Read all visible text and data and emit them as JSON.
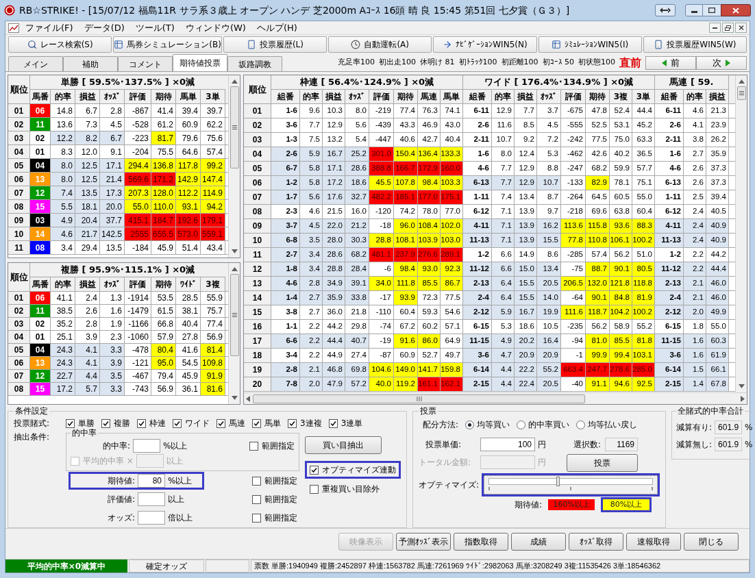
{
  "window": {
    "title": "RB☆STRIKE! - [15/07/12 福島11R サラ系３歳上 オープン ハンデ 芝2000m Aｺｰｽ  16頭 晴 良 15:45 第51回 七夕賞（Ｇ３）]"
  },
  "menu": [
    "ファイル(F)",
    "データ(D)",
    "ツール(T)",
    "ウィンドウ(W)",
    "ヘルプ(H)"
  ],
  "toolbar": [
    {
      "label": "レース検索(S)",
      "kind": "search"
    },
    {
      "label": "馬券シミュレーション(B)",
      "kind": "grid"
    },
    {
      "label": "投票履歴(L)",
      "kind": "doc"
    },
    {
      "label": "自動運転(A)",
      "kind": "clock"
    },
    {
      "label": "ﾅﾋﾞｹﾞｰｼｮﾝWIN5(N)",
      "kind": "arrow"
    },
    {
      "label": "ｼﾐｭﾚｰｼｮﾝWIN5(I)",
      "kind": "grid"
    },
    {
      "label": "投票履歴WIN5(W)",
      "kind": "doc"
    }
  ],
  "tabs": [
    {
      "label": "メイン",
      "selected": false
    },
    {
      "label": "補助",
      "selected": false
    },
    {
      "label": "コメント",
      "selected": false
    },
    {
      "label": "期待値投票",
      "selected": true
    },
    {
      "label": "坂路調教",
      "selected": false
    }
  ],
  "stats": [
    "充足率100",
    "初出走100",
    "休明け 81",
    "初ﾄﾗｯｸ100",
    "初距離100",
    "初ｺｰｽ 50",
    "初状態100"
  ],
  "timing": "直前",
  "nav": {
    "prev": "前",
    "next": "次"
  },
  "win_tables": [
    {
      "rank_header": "順位",
      "title": "単勝 [ 59.5%･137.5% ] ×0減",
      "headers": [
        "馬番",
        "的率",
        "損益",
        "ｵｯｽﾞ",
        "評価",
        "期待",
        "馬単",
        "3単"
      ],
      "rows": [
        {
          "rank": "01",
          "horse": "06",
          "color": "#ff0000",
          "selected": false,
          "cells": [
            "14.8",
            "6.7",
            "2.8",
            "-867",
            "41.4",
            "39.4",
            "39.7"
          ]
        },
        {
          "rank": "02",
          "horse": "11",
          "color": "#009900",
          "selected": false,
          "cells": [
            "13.6",
            "7.3",
            "4.5",
            "-528",
            "61.2",
            "60.9",
            "62.2"
          ]
        },
        {
          "rank": "03",
          "horse": "02",
          "color": "#ffffff",
          "selected": true,
          "cells": [
            "12.2",
            "8.2",
            "6.7",
            "-223",
            {
              "text": "81.7",
              "color": "#ffff00"
            },
            "79.6",
            "75.6"
          ]
        },
        {
          "rank": "04",
          "horse": "01",
          "color": "#ffffff",
          "selected": false,
          "cells": [
            "8.3",
            "12.0",
            "9.1",
            "-204",
            "75.5",
            "64.6",
            "57.4"
          ]
        },
        {
          "rank": "05",
          "horse": "04",
          "color": "#000000",
          "selected": true,
          "cells": [
            "8.0",
            "12.5",
            "17.1",
            {
              "text": "294.4",
              "color": "#ffff00"
            },
            {
              "text": "136.8",
              "color": "#ffff00"
            },
            {
              "text": "117.8",
              "color": "#ffff00"
            },
            {
              "text": "99.2",
              "color": "#ffff00"
            }
          ]
        },
        {
          "rank": "06",
          "horse": "13",
          "color": "#ff9900",
          "selected": true,
          "cells": [
            "8.0",
            "12.5",
            "21.4",
            {
              "text": "569.6",
              "color": "#ff0000"
            },
            {
              "text": "171.2",
              "color": "#ff0000"
            },
            {
              "text": "142.9",
              "color": "#ffff00"
            },
            {
              "text": "147.4",
              "color": "#ffff00"
            }
          ]
        },
        {
          "rank": "07",
          "horse": "12",
          "color": "#009900",
          "selected": true,
          "cells": [
            "7.4",
            "13.5",
            "17.3",
            {
              "text": "207.3",
              "color": "#ffff00"
            },
            {
              "text": "128.0",
              "color": "#ffff00"
            },
            {
              "text": "112.2",
              "color": "#ffff00"
            },
            {
              "text": "114.9",
              "color": "#ffff00"
            }
          ]
        },
        {
          "rank": "08",
          "horse": "15",
          "color": "#ff00ff",
          "selected": true,
          "cells": [
            "5.5",
            "18.1",
            "20.0",
            {
              "text": "55.0",
              "color": "#ffff00"
            },
            {
              "text": "110.0",
              "color": "#ffff00"
            },
            {
              "text": "93.1",
              "color": "#ffff00"
            },
            {
              "text": "94.2",
              "color": "#ffff00"
            }
          ]
        },
        {
          "rank": "09",
          "horse": "03",
          "color": "#000000",
          "selected": true,
          "cells": [
            "4.9",
            "20.4",
            "37.7",
            {
              "text": "415.1",
              "color": "#ff0000"
            },
            {
              "text": "184.7",
              "color": "#ff0000"
            },
            {
              "text": "192.6",
              "color": "#ff0000"
            },
            {
              "text": "179.1",
              "color": "#ff0000"
            }
          ]
        },
        {
          "rank": "10",
          "horse": "14",
          "color": "#ff9900",
          "selected": true,
          "cells": [
            "4.6",
            "21.7",
            "142.5",
            {
              "text": "2555",
              "color": "#ff0000"
            },
            {
              "text": "655.5",
              "color": "#ff0000"
            },
            {
              "text": "573.0",
              "color": "#ff0000"
            },
            {
              "text": "559.1",
              "color": "#ff0000"
            }
          ]
        },
        {
          "rank": "11",
          "horse": "08",
          "color": "#0000ff",
          "selected": false,
          "cells": [
            "3.4",
            "29.4",
            "13.5",
            "-184",
            "45.9",
            "51.4",
            "43.4"
          ]
        }
      ]
    },
    {
      "rank_header": "順位",
      "title": "複勝 [ 95.9%･115.1% ] ×0減",
      "headers": [
        "馬番",
        "的率",
        "損益",
        "ｵｯｽﾞ",
        "評価",
        "期待",
        "ﾜｲﾄﾞ",
        "3複"
      ],
      "rows": [
        {
          "rank": "01",
          "horse": "06",
          "color": "#ff0000",
          "selected": false,
          "cells": [
            "41.1",
            "2.4",
            "1.3",
            "-1914",
            "53.5",
            "28.5",
            "55.9"
          ]
        },
        {
          "rank": "02",
          "horse": "11",
          "color": "#009900",
          "selected": false,
          "cells": [
            "38.5",
            "2.6",
            "1.6",
            "-1479",
            "61.5",
            "38.1",
            "75.7"
          ]
        },
        {
          "rank": "03",
          "horse": "02",
          "color": "#ffffff",
          "selected": false,
          "cells": [
            "35.2",
            "2.8",
            "1.9",
            "-1166",
            "66.8",
            "40.4",
            "77.4"
          ]
        },
        {
          "rank": "04",
          "horse": "01",
          "color": "#ffffff",
          "selected": false,
          "cells": [
            "25.1",
            "3.9",
            "2.3",
            "-1060",
            "57.9",
            "27.8",
            "56.9"
          ]
        },
        {
          "rank": "05",
          "horse": "04",
          "color": "#000000",
          "selected": true,
          "cells": [
            "24.3",
            "4.1",
            "3.3",
            "-478",
            {
              "text": "80.4",
              "color": "#ffff00"
            },
            "41.6",
            {
              "text": "81.4",
              "color": "#ffff00"
            }
          ]
        },
        {
          "rank": "06",
          "horse": "13",
          "color": "#ff9900",
          "selected": true,
          "cells": [
            "24.3",
            "4.1",
            "3.9",
            "-121",
            {
              "text": "95.0",
              "color": "#ffff00"
            },
            "54.5",
            {
              "text": "109.8",
              "color": "#ffff00"
            }
          ]
        },
        {
          "rank": "07",
          "horse": "12",
          "color": "#009900",
          "selected": true,
          "cells": [
            "22.7",
            "4.4",
            "3.5",
            "-467",
            "79.4",
            "45.9",
            {
              "text": "91.9",
              "color": "#ffff00"
            }
          ]
        },
        {
          "rank": "08",
          "horse": "15",
          "color": "#ff00ff",
          "selected": true,
          "cells": [
            "17.2",
            "5.7",
            "3.3",
            "-743",
            "56.9",
            "36.1",
            {
              "text": "81.6",
              "color": "#ffff00"
            }
          ]
        }
      ]
    }
  ],
  "grid": {
    "rank_header": "順位",
    "sections": [
      {
        "title": "枠連 [ 56.4%･124.9% ] ×0減",
        "headers": [
          "組番",
          "的率",
          "損益",
          "ｵｯｽﾞ",
          "評価",
          "期待",
          "馬連",
          "馬単"
        ]
      },
      {
        "title": "ワイド [ 176.4%･134.9% ] ×0減",
        "headers": [
          "組番",
          "的率",
          "損益",
          "ｵｯｽﾞ",
          "評価",
          "期待",
          "3複",
          "3単"
        ]
      },
      {
        "title": "馬連 [ 59.",
        "headers": [
          "組番",
          "的率",
          "損益"
        ]
      }
    ],
    "rows": [
      {
        "rank": "01",
        "groups": [
          {
            "combo": "1-6",
            "selected": false,
            "cells": [
              "9.6",
              "10.3",
              "8.0",
              "-219",
              "77.4",
              "76.3",
              "74.1"
            ]
          },
          {
            "combo": "6-11",
            "selected": false,
            "cells": [
              "12.9",
              "7.7",
              "3.7",
              "-675",
              "47.8",
              "52.4",
              "44.4"
            ]
          },
          {
            "combo": "6-11",
            "selected": false,
            "cells": [
              "4.6",
              "21.3"
            ]
          }
        ]
      },
      {
        "rank": "02",
        "groups": [
          {
            "combo": "3-6",
            "selected": false,
            "cells": [
              "7.7",
              "12.9",
              "5.6",
              "-439",
              "43.3",
              "46.9",
              "43.0"
            ]
          },
          {
            "combo": "2-6",
            "selected": false,
            "cells": [
              "11.6",
              "8.5",
              "4.5",
              "-555",
              "52.5",
              "53.1",
              "45.2"
            ]
          },
          {
            "combo": "2-6",
            "selected": false,
            "cells": [
              "4.1",
              "23.9"
            ]
          }
        ]
      },
      {
        "rank": "03",
        "groups": [
          {
            "combo": "1-3",
            "selected": false,
            "cells": [
              "7.5",
              "13.2",
              "5.4",
              "-447",
              "40.6",
              "42.7",
              "40.4"
            ]
          },
          {
            "combo": "2-11",
            "selected": false,
            "cells": [
              "10.7",
              "9.2",
              "7.2",
              "-242",
              "77.5",
              "75.0",
              "63.3"
            ]
          },
          {
            "combo": "2-11",
            "selected": false,
            "cells": [
              "3.8",
              "26.2"
            ]
          }
        ]
      },
      {
        "rank": "04",
        "groups": [
          {
            "combo": "2-6",
            "selected": true,
            "cells": [
              "5.9",
              "16.7",
              "25.2",
              {
                "text": "301.0",
                "color": "#ff0000"
              },
              {
                "text": "150.4",
                "color": "#ffff00"
              },
              {
                "text": "136.4",
                "color": "#ffff00"
              },
              {
                "text": "133.3",
                "color": "#ffff00"
              }
            ]
          },
          {
            "combo": "1-6",
            "selected": false,
            "cells": [
              "8.0",
              "12.4",
              "5.3",
              "-462",
              "42.6",
              "40.2",
              "36.5"
            ]
          },
          {
            "combo": "1-6",
            "selected": false,
            "cells": [
              "2.7",
              "35.9"
            ]
          }
        ]
      },
      {
        "rank": "05",
        "groups": [
          {
            "combo": "6-7",
            "selected": true,
            "cells": [
              "5.8",
              "17.1",
              "28.6",
              {
                "text": "388.8",
                "color": "#ff0000"
              },
              {
                "text": "166.7",
                "color": "#ff0000"
              },
              {
                "text": "172.9",
                "color": "#ff0000"
              },
              {
                "text": "160.0",
                "color": "#ff0000"
              }
            ]
          },
          {
            "combo": "4-6",
            "selected": false,
            "cells": [
              "7.7",
              "12.9",
              "8.8",
              "-247",
              "68.2",
              "59.9",
              "57.7"
            ]
          },
          {
            "combo": "4-6",
            "selected": false,
            "cells": [
              "2.6",
              "37.3"
            ]
          }
        ]
      },
      {
        "rank": "06",
        "groups": [
          {
            "combo": "1-2",
            "selected": true,
            "cells": [
              "5.8",
              "17.2",
              "18.6",
              {
                "text": "45.5",
                "color": "#ffff00"
              },
              {
                "text": "107.8",
                "color": "#ffff00"
              },
              {
                "text": "98.4",
                "color": "#ffff00"
              },
              {
                "text": "103.3",
                "color": "#ffff00"
              }
            ]
          },
          {
            "combo": "6-13",
            "selected": true,
            "cells": [
              "7.7",
              "12.9",
              "10.7",
              "-133",
              {
                "text": "82.9",
                "color": "#ffff00"
              },
              "78.1",
              "75.1"
            ]
          },
          {
            "combo": "6-13",
            "selected": false,
            "cells": [
              "2.6",
              "37.3"
            ]
          }
        ]
      },
      {
        "rank": "07",
        "groups": [
          {
            "combo": "1-7",
            "selected": true,
            "cells": [
              "5.6",
              "17.6",
              "32.7",
              {
                "text": "482.2",
                "color": "#ff0000"
              },
              {
                "text": "185.1",
                "color": "#ff0000"
              },
              {
                "text": "177.0",
                "color": "#ff0000"
              },
              {
                "text": "175.1",
                "color": "#ff0000"
              }
            ]
          },
          {
            "combo": "1-11",
            "selected": false,
            "cells": [
              "7.4",
              "13.4",
              "8.7",
              "-264",
              "64.5",
              "60.5",
              "55.0"
            ]
          },
          {
            "combo": "1-11",
            "selected": false,
            "cells": [
              "2.5",
              "39.4"
            ]
          }
        ]
      },
      {
        "rank": "08",
        "groups": [
          {
            "combo": "2-3",
            "selected": false,
            "cells": [
              "4.6",
              "21.5",
              "16.0",
              "-120",
              "74.2",
              "78.0",
              "77.0"
            ]
          },
          {
            "combo": "6-12",
            "selected": false,
            "cells": [
              "7.1",
              "13.9",
              "9.7",
              "-218",
              "69.6",
              "63.8",
              "60.4"
            ]
          },
          {
            "combo": "6-12",
            "selected": false,
            "cells": [
              "2.4",
              "40.5"
            ]
          }
        ]
      },
      {
        "rank": "09",
        "groups": [
          {
            "combo": "3-7",
            "selected": true,
            "cells": [
              "4.5",
              "22.0",
              "21.2",
              "-18",
              {
                "text": "96.0",
                "color": "#ffff00"
              },
              {
                "text": "108.4",
                "color": "#ffff00"
              },
              {
                "text": "102.0",
                "color": "#ffff00"
              }
            ]
          },
          {
            "combo": "4-11",
            "selected": true,
            "cells": [
              "7.1",
              "13.9",
              "16.2",
              {
                "text": "113.6",
                "color": "#ffff00"
              },
              {
                "text": "115.8",
                "color": "#ffff00"
              },
              {
                "text": "93.6",
                "color": "#ffff00"
              },
              {
                "text": "88.3",
                "color": "#ffff00"
              }
            ]
          },
          {
            "combo": "4-11",
            "selected": true,
            "cells": [
              "2.4",
              "40.9"
            ]
          }
        ]
      },
      {
        "rank": "10",
        "groups": [
          {
            "combo": "6-8",
            "selected": true,
            "cells": [
              "3.5",
              "28.0",
              "30.3",
              {
                "text": "28.8",
                "color": "#ffff00"
              },
              {
                "text": "108.1",
                "color": "#ffff00"
              },
              {
                "text": "103.9",
                "color": "#ffff00"
              },
              {
                "text": "103.0",
                "color": "#ffff00"
              }
            ]
          },
          {
            "combo": "11-13",
            "selected": true,
            "cells": [
              "7.1",
              "13.9",
              "15.5",
              {
                "text": "77.8",
                "color": "#ffff00"
              },
              {
                "text": "110.8",
                "color": "#ffff00"
              },
              {
                "text": "106.1",
                "color": "#ffff00"
              },
              {
                "text": "100.2",
                "color": "#ffff00"
              }
            ]
          },
          {
            "combo": "11-13",
            "selected": true,
            "cells": [
              "2.4",
              "40.9"
            ]
          }
        ]
      },
      {
        "rank": "11",
        "groups": [
          {
            "combo": "2-7",
            "selected": true,
            "cells": [
              "3.4",
              "28.6",
              "68.2",
              {
                "text": "481.1",
                "color": "#ff0000"
              },
              {
                "text": "237.9",
                "color": "#ff0000"
              },
              {
                "text": "276.6",
                "color": "#ff0000"
              },
              {
                "text": "289.1",
                "color": "#ff0000"
              }
            ]
          },
          {
            "combo": "1-2",
            "selected": false,
            "cells": [
              "6.6",
              "14.9",
              "8.6",
              "-285",
              "57.4",
              "56.2",
              "51.0"
            ]
          },
          {
            "combo": "1-2",
            "selected": false,
            "cells": [
              "2.2",
              "44.2"
            ]
          }
        ]
      },
      {
        "rank": "12",
        "groups": [
          {
            "combo": "1-8",
            "selected": true,
            "cells": [
              "3.4",
              "28.8",
              "28.4",
              "-6",
              {
                "text": "98.4",
                "color": "#ffff00"
              },
              {
                "text": "93.0",
                "color": "#ffff00"
              },
              {
                "text": "92.3",
                "color": "#ffff00"
              }
            ]
          },
          {
            "combo": "11-12",
            "selected": true,
            "cells": [
              "6.6",
              "15.0",
              "13.4",
              "-75",
              {
                "text": "88.7",
                "color": "#ffff00"
              },
              {
                "text": "90.1",
                "color": "#ffff00"
              },
              {
                "text": "80.5",
                "color": "#ffff00"
              }
            ]
          },
          {
            "combo": "11-12",
            "selected": true,
            "cells": [
              "2.2",
              "44.4"
            ]
          }
        ]
      },
      {
        "rank": "13",
        "groups": [
          {
            "combo": "4-6",
            "selected": true,
            "cells": [
              "2.8",
              "34.9",
              "39.1",
              {
                "text": "34.0",
                "color": "#ffff00"
              },
              {
                "text": "111.8",
                "color": "#ffff00"
              },
              {
                "text": "85.5",
                "color": "#ffff00"
              },
              {
                "text": "86.7",
                "color": "#ffff00"
              }
            ]
          },
          {
            "combo": "2-13",
            "selected": true,
            "cells": [
              "6.4",
              "15.5",
              "20.5",
              {
                "text": "206.5",
                "color": "#ffff00"
              },
              {
                "text": "132.0",
                "color": "#ffff00"
              },
              {
                "text": "121.8",
                "color": "#ffff00"
              },
              {
                "text": "118.8",
                "color": "#ffff00"
              }
            ]
          },
          {
            "combo": "2-13",
            "selected": true,
            "cells": [
              "2.1",
              "46.0"
            ]
          }
        ]
      },
      {
        "rank": "14",
        "groups": [
          {
            "combo": "1-4",
            "selected": true,
            "cells": [
              "2.7",
              "35.9",
              "33.8",
              "-17",
              {
                "text": "93.9",
                "color": "#ffff00"
              },
              "72.3",
              "77.5"
            ]
          },
          {
            "combo": "2-4",
            "selected": true,
            "cells": [
              "6.4",
              "15.5",
              "14.0",
              "-64",
              {
                "text": "90.1",
                "color": "#ffff00"
              },
              {
                "text": "84.8",
                "color": "#ffff00"
              },
              {
                "text": "81.9",
                "color": "#ffff00"
              }
            ]
          },
          {
            "combo": "2-4",
            "selected": true,
            "cells": [
              "2.1",
              "46.0"
            ]
          }
        ]
      },
      {
        "rank": "15",
        "groups": [
          {
            "combo": "3-8",
            "selected": false,
            "cells": [
              "2.7",
              "36.0",
              "21.8",
              "-110",
              "60.4",
              "59.3",
              "54.6"
            ]
          },
          {
            "combo": "2-12",
            "selected": true,
            "cells": [
              "5.9",
              "16.7",
              "19.9",
              {
                "text": "111.6",
                "color": "#ffff00"
              },
              {
                "text": "118.7",
                "color": "#ffff00"
              },
              {
                "text": "104.2",
                "color": "#ffff00"
              },
              {
                "text": "100.2",
                "color": "#ffff00"
              }
            ]
          },
          {
            "combo": "2-12",
            "selected": true,
            "cells": [
              "2.0",
              "49.9"
            ]
          }
        ]
      },
      {
        "rank": "16",
        "groups": [
          {
            "combo": "1-1",
            "selected": false,
            "cells": [
              "2.2",
              "44.2",
              "29.8",
              "-74",
              "67.2",
              "60.2",
              "57.1"
            ]
          },
          {
            "combo": "6-15",
            "selected": false,
            "cells": [
              "5.3",
              "18.6",
              "10.5",
              "-235",
              "56.2",
              "58.9",
              "55.2"
            ]
          },
          {
            "combo": "6-15",
            "selected": false,
            "cells": [
              "1.8",
              "55.0"
            ]
          }
        ]
      },
      {
        "rank": "17",
        "groups": [
          {
            "combo": "6-6",
            "selected": true,
            "cells": [
              "2.2",
              "44.4",
              "40.7",
              "-19",
              {
                "text": "91.6",
                "color": "#ffff00"
              },
              {
                "text": "86.0",
                "color": "#ffff00"
              },
              "64.9"
            ]
          },
          {
            "combo": "11-15",
            "selected": true,
            "cells": [
              "4.9",
              "20.2",
              "16.4",
              "-94",
              {
                "text": "81.0",
                "color": "#ffff00"
              },
              {
                "text": "85.5",
                "color": "#ffff00"
              },
              {
                "text": "81.8",
                "color": "#ffff00"
              }
            ]
          },
          {
            "combo": "11-15",
            "selected": true,
            "cells": [
              "1.6",
              "60.3"
            ]
          }
        ]
      },
      {
        "rank": "18",
        "groups": [
          {
            "combo": "3-4",
            "selected": false,
            "cells": [
              "2.2",
              "44.9",
              "27.4",
              "-87",
              "60.9",
              "52.7",
              "49.7"
            ]
          },
          {
            "combo": "3-6",
            "selected": true,
            "cells": [
              "4.7",
              "20.9",
              "20.9",
              "-1",
              {
                "text": "99.9",
                "color": "#ffff00"
              },
              {
                "text": "99.4",
                "color": "#ffff00"
              },
              {
                "text": "103.1",
                "color": "#ffff00"
              }
            ]
          },
          {
            "combo": "3-6",
            "selected": true,
            "cells": [
              "1.6",
              "61.9"
            ]
          }
        ]
      },
      {
        "rank": "19",
        "groups": [
          {
            "combo": "2-8",
            "selected": true,
            "cells": [
              "2.1",
              "46.8",
              "69.8",
              {
                "text": "104.6",
                "color": "#ffff00"
              },
              {
                "text": "149.0",
                "color": "#ffff00"
              },
              {
                "text": "141.7",
                "color": "#ffff00"
              },
              {
                "text": "159.8",
                "color": "#ffff00"
              }
            ]
          },
          {
            "combo": "6-14",
            "selected": true,
            "cells": [
              "4.4",
              "22.2",
              "55.2",
              {
                "text": "663.4",
                "color": "#ff0000"
              },
              {
                "text": "247.7",
                "color": "#ff0000"
              },
              {
                "text": "278.6",
                "color": "#ff0000"
              },
              {
                "text": "285.0",
                "color": "#ff0000"
              }
            ]
          },
          {
            "combo": "6-14",
            "selected": true,
            "cells": [
              "1.5",
              "66.1"
            ]
          }
        ]
      },
      {
        "rank": "20",
        "groups": [
          {
            "combo": "7-8",
            "selected": true,
            "cells": [
              "2.0",
              "47.9",
              "57.2",
              {
                "text": "40.0",
                "color": "#ffff00"
              },
              {
                "text": "119.2",
                "color": "#ffff00"
              },
              {
                "text": "161.1",
                "color": "#ff0000"
              },
              {
                "text": "162.1",
                "color": "#ff0000"
              }
            ]
          },
          {
            "combo": "2-15",
            "selected": true,
            "cells": [
              "4.4",
              "22.4",
              "20.5",
              "-40",
              {
                "text": "91.1",
                "color": "#ffff00"
              },
              {
                "text": "94.6",
                "color": "#ffff00"
              },
              {
                "text": "92.5",
                "color": "#ffff00"
              }
            ]
          },
          {
            "combo": "2-15",
            "selected": true,
            "cells": [
              "1.4",
              "67.8"
            ]
          }
        ]
      }
    ]
  },
  "conditions": {
    "title": "条件設定",
    "bet_types_label": "投票賭式:",
    "bet_types": [
      {
        "label": "単勝",
        "checked": true
      },
      {
        "label": "複勝",
        "checked": true
      },
      {
        "label": "枠連",
        "checked": true
      },
      {
        "label": "ワイド",
        "checked": true
      },
      {
        "label": "馬連",
        "checked": true
      },
      {
        "label": "馬単",
        "checked": true
      },
      {
        "label": "3連複",
        "checked": true
      },
      {
        "label": "3連単",
        "checked": true
      }
    ],
    "extract_label": "抽出条件:",
    "hit_group": {
      "title": "的中率",
      "label": "的中率:",
      "unit": "%以上",
      "range_label": "範囲指定",
      "range_checked": false,
      "average": {
        "label": "平均的中率 ×",
        "unit": "以上",
        "checked": false,
        "disabled": true
      }
    },
    "rows": [
      {
        "label": "期待値:",
        "value": "80",
        "unit": "%以上",
        "highlighted": true,
        "range_label": "範囲指定",
        "range_checked": false
      },
      {
        "label": "評価値:",
        "unit": "以上",
        "highlighted": false,
        "range_label": "範囲指定",
        "range_checked": false
      },
      {
        "label": "オッズ:",
        "unit": "倍以上",
        "highlighted": false,
        "range_label": "範囲指定",
        "range_checked": false
      }
    ],
    "extract_button": "買い目抽出",
    "options": [
      {
        "label": "オプティマイズ連動",
        "checked": true,
        "highlighted": true
      },
      {
        "label": "重複買い目除外",
        "checked": false,
        "highlighted": false
      }
    ]
  },
  "vote": {
    "title": "投票",
    "method_label": "配分方法:",
    "methods": [
      {
        "label": "均等買い",
        "selected": true
      },
      {
        "label": "的中率買い",
        "selected": false
      },
      {
        "label": "均等払い戻し",
        "selected": false
      }
    ],
    "unit_price": {
      "label": "投票単価:",
      "value": "100",
      "unit": "円"
    },
    "selection_count": {
      "label": "選択数:",
      "value": "1169"
    },
    "total": {
      "label": "トータル金額:",
      "unit": "円",
      "disabled": true
    },
    "vote_button": "投票",
    "optimize": {
      "label": "オプティマイズ:",
      "level": 0.41,
      "highlighted": true
    },
    "legend_label": "期待値:",
    "legend": [
      {
        "label": "160%以上",
        "color": "#ff0000",
        "highlighted": false
      },
      {
        "label": "80%以上",
        "color": "#ffff00",
        "highlighted": true
      }
    ]
  },
  "totals": {
    "title": "全賭式的中率合計",
    "rows": [
      {
        "label": "減算有り:",
        "value": "601.9",
        "unit": "%"
      },
      {
        "label": "減算無し:",
        "value": "601.9",
        "unit": "%"
      }
    ]
  },
  "buttons": [
    {
      "label": "映像表示",
      "disabled": true
    },
    {
      "label": "予測ｵｯｽﾞ表示",
      "disabled": false
    },
    {
      "label": "指数取得",
      "disabled": false
    },
    {
      "label": "成績",
      "disabled": false
    },
    {
      "label": "ｵｯｽﾞ取得",
      "disabled": false
    },
    {
      "label": "速報取得",
      "disabled": false
    },
    {
      "label": "閉じる",
      "disabled": false
    }
  ],
  "status_bar": {
    "mode": "平均的中率×0減算中",
    "odds_type": "確定オッズ",
    "counts": "票数 単勝:1940949 複勝:2452897 枠連:1563782 馬連:7261969 ﾜｲﾄﾞ:2982063 馬単:3208249 3複:11535426 3単:18546362"
  }
}
